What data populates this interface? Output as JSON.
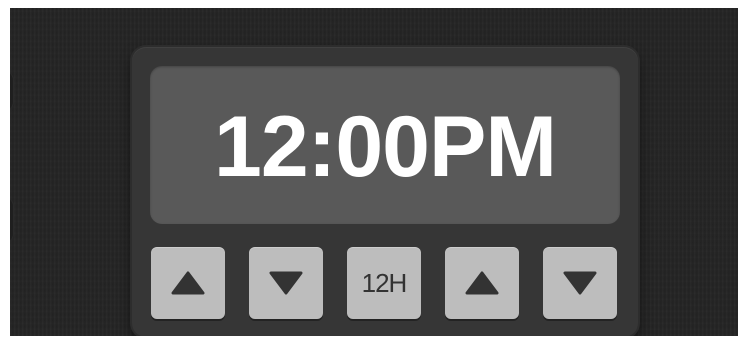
{
  "clock": {
    "time": "12:00PM"
  },
  "buttons": [
    {
      "icon": "up-triangle-icon"
    },
    {
      "icon": "down-triangle-icon"
    },
    {
      "label": "12H"
    },
    {
      "icon": "up-triangle-icon"
    },
    {
      "icon": "down-triangle-icon"
    }
  ],
  "colors": {
    "background": "#252525",
    "panel": "#363636",
    "display": "#595959",
    "time_text": "#ffffff",
    "button": "#bdbdbd",
    "button_icon": "#333333"
  }
}
